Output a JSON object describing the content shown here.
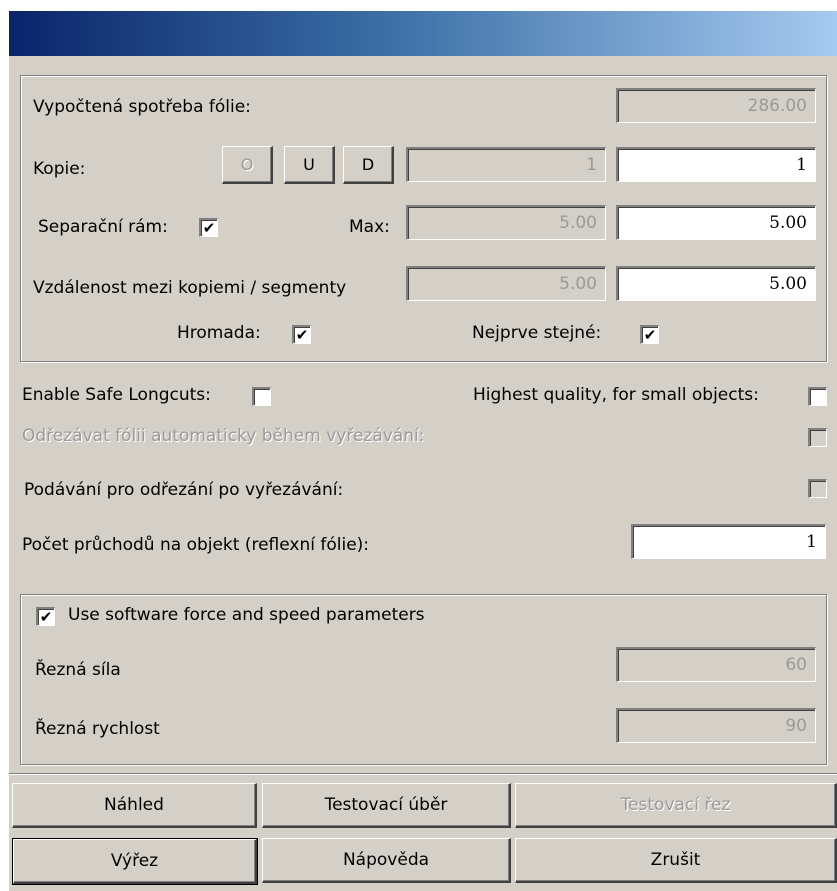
{
  "group1": {
    "consumption_label": "Vypočtená spotřeba fólie:",
    "consumption_value": "286.00",
    "copies_label": "Kopie:",
    "btn_o": "O",
    "btn_u": "U",
    "btn_d": "D",
    "copies_computed": "1",
    "copies_value": "1",
    "separation_label": "Separační rám:",
    "separation_checked": "✔",
    "max_label": "Max:",
    "max_computed": "5.00",
    "max_value": "5.00",
    "distance_label": "Vzdálenost mezi kopiemi / segmenty",
    "distance_computed": "5.00",
    "distance_value": "5.00",
    "pile_label": "Hromada:",
    "pile_checked": "✔",
    "same_first_label": "Nejprve stejné:",
    "same_first_checked": "✔"
  },
  "options": {
    "safe_longcuts_label": "Enable Safe Longcuts:",
    "highest_quality_label": "Highest quality, for small objects:",
    "auto_cut_label": "Odřezávat fólii automaticky během vyřezávání:",
    "feed_label": "Podávání pro odřezání po vyřezávání:",
    "passes_label": "Počet průchodů na objekt (reflexní fólie):",
    "passes_value": "1"
  },
  "group2": {
    "use_sw_label": "Use software force and speed parameters",
    "use_sw_checked": "✔",
    "force_label": "Řezná síla",
    "force_value": "60",
    "speed_label": "Řezná rychlost",
    "speed_value": "90"
  },
  "buttons": {
    "preview": "Náhled",
    "test_weed": "Testovací úběr",
    "test_cut": "Testovací řez",
    "cut": "Výřez",
    "help": "Nápověda",
    "cancel": "Zrušit"
  },
  "colors": {
    "dialog_bg": "#d4d0c8",
    "title_start": "#0a246a",
    "title_end": "#a6caf0"
  }
}
